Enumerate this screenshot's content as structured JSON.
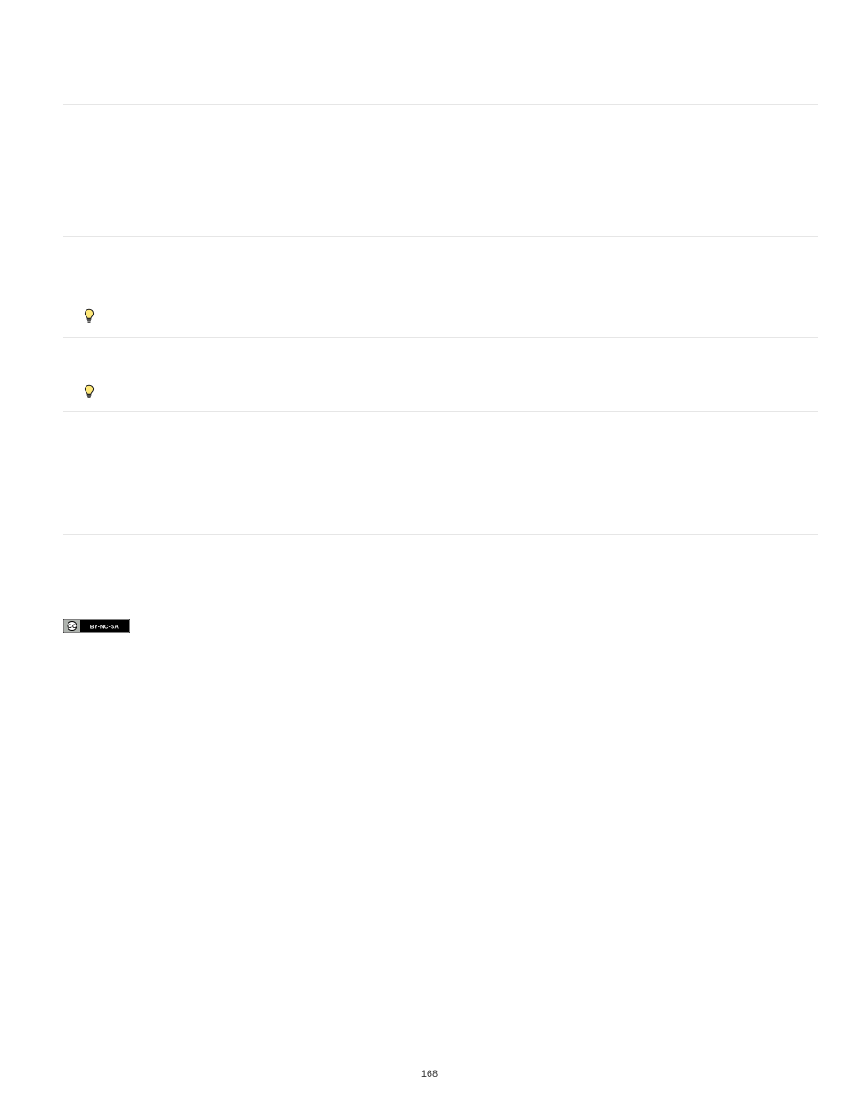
{
  "page_number": "168",
  "dividers": 5,
  "sections": {
    "block1": "",
    "block2": "",
    "tip1": "",
    "tip2": "",
    "block3": ""
  },
  "icons": {
    "tip": "lightbulb-icon"
  },
  "license_badge": {
    "label_left": "CC",
    "label_right": "BY-NC-SA"
  }
}
